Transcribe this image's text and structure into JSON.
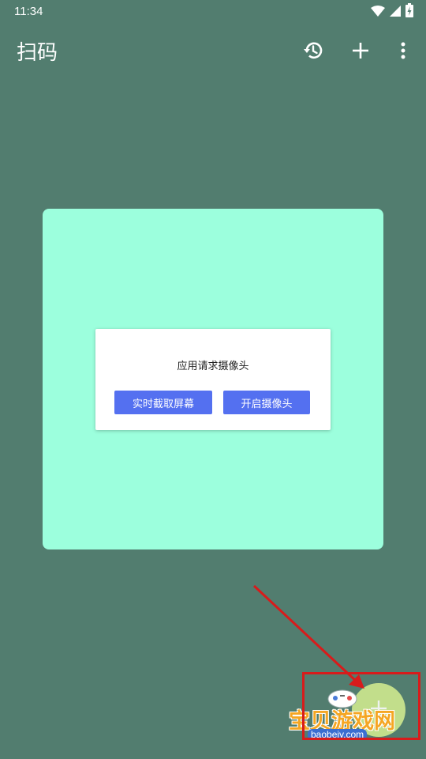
{
  "status_bar": {
    "time": "11:34",
    "icons": [
      "wifi-icon",
      "signal-icon",
      "battery-charging-icon"
    ]
  },
  "app_bar": {
    "title": "扫码",
    "actions": [
      "history-icon",
      "add-icon",
      "more-vert-icon"
    ]
  },
  "dialog": {
    "message": "应用请求摄像头",
    "screen_capture_button": "实时截取屏幕",
    "camera_button": "开启摄像头"
  },
  "watermark": {
    "brand_text": "宝贝游戏网",
    "url_text": "baobeiy.com"
  },
  "colors": {
    "background": "#527d6f",
    "card": "#9cffdd",
    "dialog_button": "#5470f0",
    "annotation_red": "#d81b1b",
    "fab": "#cfe98f"
  }
}
